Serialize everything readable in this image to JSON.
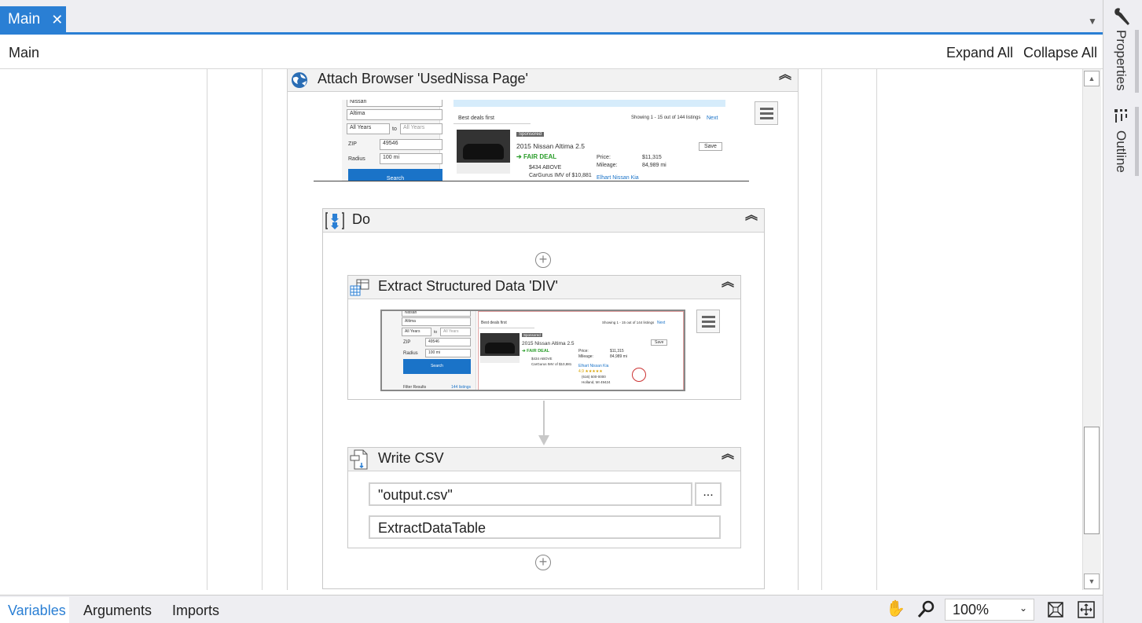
{
  "tabs": {
    "main_label": "Main",
    "close_glyph": "✕",
    "dropdown_glyph": "▼"
  },
  "header": {
    "breadcrumb": "Main",
    "expand_all": "Expand All",
    "collapse_all": "Collapse All"
  },
  "right_panel": {
    "properties": "Properties",
    "outline": "Outline"
  },
  "activities": {
    "attach_browser": {
      "title": "Attach Browser 'UsedNissa Page'",
      "screenshot": {
        "make": "Nissan",
        "model": "Altima",
        "year_from": "All Years",
        "year_to_label": "to",
        "year_to": "All Years",
        "zip_label": "ZIP",
        "zip_value": "49546",
        "radius_label": "Radius",
        "radius_value": "100 mi",
        "search": "Search",
        "sort": "Best deals first",
        "showing": "Showing 1 - 15 out of 144 listings",
        "next": "Next",
        "badge": "Sponsored",
        "listing_title": "2015 Nissan Altima 2.5",
        "deal": "FAIR DEAL",
        "below": "$434 ABOVE",
        "cargurus": "CarGurus IMV of $10,881",
        "price_label": "Price:",
        "price_value": "$11,315",
        "mileage_label": "Mileage:",
        "mileage_value": "84,989 mi",
        "save": "Save",
        "dealer": "Elhart Nissan Kia"
      }
    },
    "do": {
      "title": "Do"
    },
    "extract": {
      "title": "Extract Structured Data 'DIV'",
      "screenshot": {
        "make": "Nissan",
        "model": "Altima",
        "year_from": "All Years",
        "year_to_label": "to",
        "year_to": "All Years",
        "zip_label": "ZIP",
        "zip_value": "49546",
        "radius_label": "Radius",
        "radius_value": "100 mi",
        "search": "Search",
        "filter": "Filter Results",
        "listings_count": "144 listings",
        "sort": "Best deals first",
        "showing": "Showing 1 - 15 out of 144 listings",
        "next": "Next",
        "badge": "Sponsored",
        "listing_title": "2015 Nissan Altima 2.5",
        "deal": "FAIR DEAL",
        "below": "$434 ABOVE",
        "cargurus": "CarGurus IMV of $10,881",
        "price_label": "Price:",
        "price_value": "$11,315",
        "mileage_label": "Mileage:",
        "mileage_value": "84,989 mi",
        "save": "Save",
        "dealer": "Elhart Nissan Kia",
        "rating": "4.9 ★★★★★",
        "phone": "(616) 500-0000",
        "city": "Holland, MI 49424"
      }
    },
    "write_csv": {
      "title": "Write CSV",
      "file_path": "\"output.csv\"",
      "browse": "...",
      "data_table": "ExtractDataTable"
    }
  },
  "footer": {
    "variables": "Variables",
    "arguments": "Arguments",
    "imports": "Imports",
    "zoom": "100%"
  },
  "colors": {
    "accent": "#2a7fd4",
    "panel_bg": "#eeeef2",
    "header_bg": "#f2f2f2"
  },
  "icons": [
    "close-icon",
    "globe-icon",
    "collapse-chevrons-icon",
    "menu-icon",
    "sequence-icon",
    "plus-icon",
    "table-icon",
    "csv-file-icon",
    "wrench-icon",
    "outline-icon",
    "hand-icon",
    "magnifier-icon",
    "fit-screen-icon",
    "overview-icon"
  ]
}
